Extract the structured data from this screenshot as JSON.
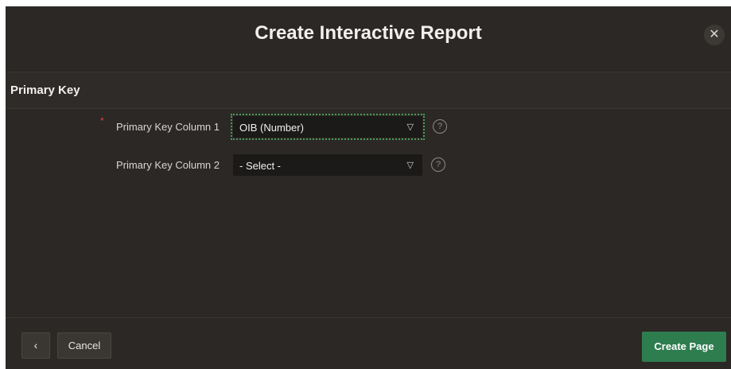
{
  "dialog": {
    "title": "Create Interactive Report",
    "close_icon": "close-icon"
  },
  "section": {
    "title": "Primary Key"
  },
  "fields": [
    {
      "label": "Primary Key Column 1",
      "required": true,
      "required_mark": "*",
      "value": "OIB (Number)",
      "help_icon": "help-icon"
    },
    {
      "label": "Primary Key Column 2",
      "required": false,
      "value": "- Select -",
      "help_icon": "help-icon"
    }
  ],
  "footer": {
    "back_icon": "chevron-left-icon",
    "cancel_label": "Cancel",
    "create_label": "Create Page"
  },
  "colors": {
    "background": "#2b2825",
    "accent": "#2e7d4f",
    "required": "#e0453a",
    "focus_outline": "#4a9a5a"
  }
}
